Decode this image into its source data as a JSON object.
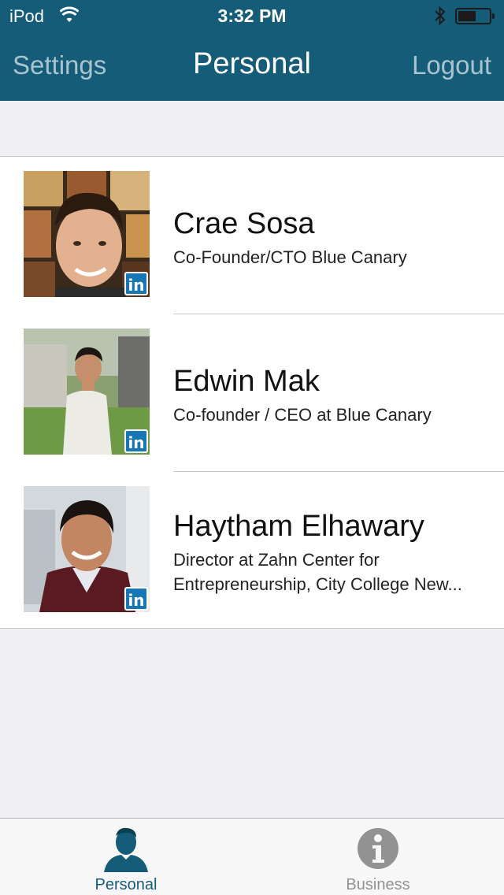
{
  "status_bar": {
    "carrier": "iPod",
    "time": "3:32 PM",
    "icons": [
      "wifi-icon",
      "bluetooth-icon",
      "battery-icon"
    ]
  },
  "nav_bar": {
    "left_label": "Settings",
    "title": "Personal",
    "right_label": "Logout"
  },
  "contacts": [
    {
      "name": "Crae Sosa",
      "title_lines": [
        "Co-Founder/CTO Blue Canary"
      ],
      "badge": "in"
    },
    {
      "name": "Edwin Mak",
      "title_lines": [
        "Co-founder / CEO at Blue Canary"
      ],
      "badge": "in"
    },
    {
      "name": "Haytham Elhawary",
      "title_lines": [
        "Director at Zahn Center for",
        "Entrepreneurship, City College New..."
      ],
      "badge": "in"
    }
  ],
  "tab_bar": {
    "tabs": [
      {
        "label": "Personal",
        "icon": "person-icon",
        "selected": true
      },
      {
        "label": "Business",
        "icon": "info-icon",
        "selected": false
      }
    ]
  },
  "colors": {
    "nav_background": "#145c78",
    "nav_button_text": "#a9c4cf",
    "linkedin_blue": "#1777b5",
    "tab_selected": "#145c78",
    "tab_unselected": "#929292"
  }
}
